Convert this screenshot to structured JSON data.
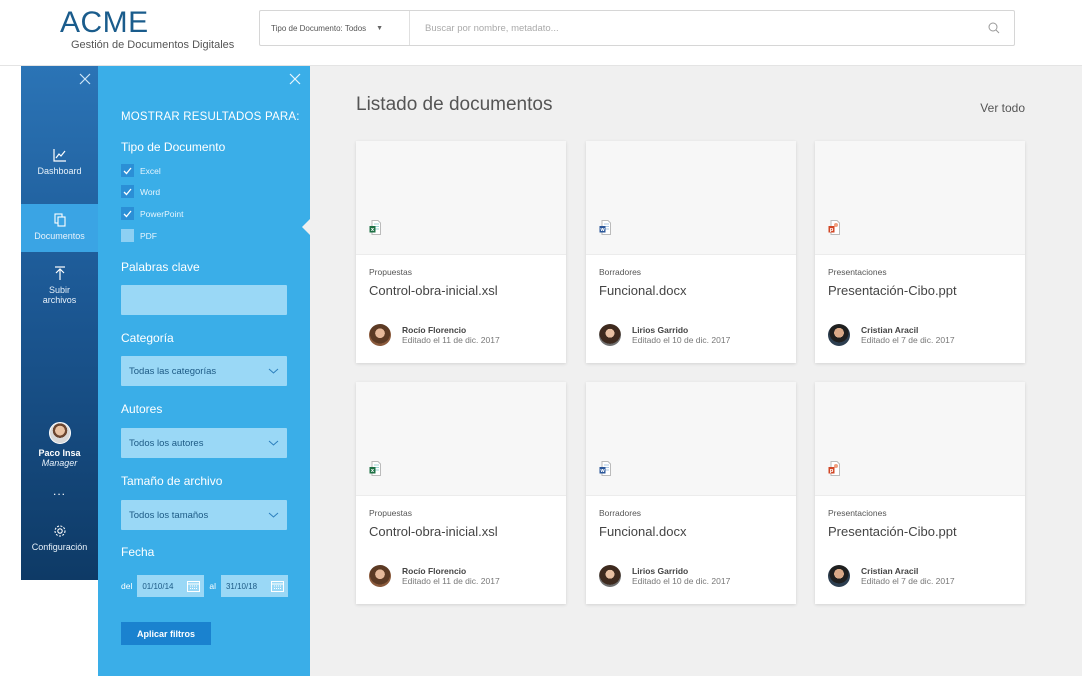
{
  "header": {
    "logo_title": "ACME",
    "logo_subtitle": "Gestión de Documentos Digitales",
    "doc_type_selector": "Tipo de Documento: Todos",
    "search_placeholder": "Buscar por nombre, metadato..."
  },
  "nav": {
    "items": [
      {
        "label": "Dashboard",
        "icon": "chart-line-icon"
      },
      {
        "label": "Documentos",
        "icon": "documents-icon",
        "active": true
      },
      {
        "label": "Subir",
        "label2": "archivos",
        "icon": "upload-icon"
      }
    ],
    "user": {
      "name": "Paco Insa",
      "role": "Manager"
    },
    "more": "...",
    "settings_label": "Configuración"
  },
  "filters": {
    "title": "MOSTRAR RESULTADOS PARA:",
    "doc_type_label": "Tipo de Documento",
    "doc_types": [
      {
        "label": "Excel",
        "checked": true
      },
      {
        "label": "Word",
        "checked": true
      },
      {
        "label": "PowerPoint",
        "checked": true
      },
      {
        "label": "PDF",
        "checked": false
      }
    ],
    "keywords_label": "Palabras clave",
    "keywords_value": "",
    "category_label": "Categoría",
    "category_value": "Todas las categorías",
    "authors_label": "Autores",
    "authors_value": "Todos los autores",
    "size_label": "Tamaño de archivo",
    "size_value": "Todos los tamaños",
    "date_label": "Fecha",
    "date_from_prefix": "del",
    "date_from": "01/10/14",
    "date_to_prefix": "al",
    "date_to": "31/10/18",
    "apply_label": "Aplicar filtros"
  },
  "main": {
    "title": "Listado de documentos",
    "see_all": "Ver todo",
    "cards": [
      {
        "category": "Propuestas",
        "filename": "Control-obra-inicial.xsl",
        "type": "excel",
        "author": "Rocío Florencio",
        "edited": "Editado el 11 de dic. 2017"
      },
      {
        "category": "Borradores",
        "filename": "Funcional.docx",
        "type": "word",
        "author": "Lirios Garrido",
        "edited": "Editado el 10 de dic. 2017"
      },
      {
        "category": "Presentaciones",
        "filename": "Presentación-Cibo.ppt",
        "type": "powerpoint",
        "author": "Cristian Aracil",
        "edited": "Editado el 7 de dic. 2017"
      },
      {
        "category": "Propuestas",
        "filename": "Control-obra-inicial.xsl",
        "type": "excel",
        "author": "Rocío Florencio",
        "edited": "Editado el 11 de dic. 2017"
      },
      {
        "category": "Borradores",
        "filename": "Funcional.docx",
        "type": "word",
        "author": "Lirios Garrido",
        "edited": "Editado el 10 de dic. 2017"
      },
      {
        "category": "Presentaciones",
        "filename": "Presentación-Cibo.ppt",
        "type": "powerpoint",
        "author": "Cristian Aracil",
        "edited": "Editado el 7 de dic. 2017"
      }
    ]
  },
  "colors": {
    "brand": "#1a5c8c",
    "filter_panel": "#3aaee8",
    "nav_active": "#3aa4e4",
    "excel": "#1e7145",
    "word": "#2b579a",
    "powerpoint": "#d24726"
  }
}
